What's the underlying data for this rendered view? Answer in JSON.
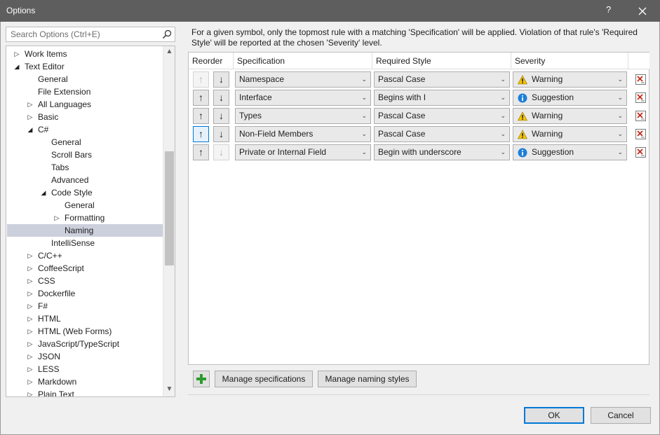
{
  "window": {
    "title": "Options",
    "help_label": "?"
  },
  "search": {
    "placeholder": "Search Options (Ctrl+E)"
  },
  "tree": {
    "items": [
      {
        "label": "Work Items",
        "expander": "collapsed"
      },
      {
        "label": "Text Editor",
        "expander": "expanded"
      },
      {
        "label": "General",
        "expander": "none"
      },
      {
        "label": "File Extension",
        "expander": "none"
      },
      {
        "label": "All Languages",
        "expander": "collapsed"
      },
      {
        "label": "Basic",
        "expander": "collapsed"
      },
      {
        "label": "C#",
        "expander": "expanded"
      },
      {
        "label": "General",
        "expander": "none"
      },
      {
        "label": "Scroll Bars",
        "expander": "none"
      },
      {
        "label": "Tabs",
        "expander": "none"
      },
      {
        "label": "Advanced",
        "expander": "none"
      },
      {
        "label": "Code Style",
        "expander": "expanded"
      },
      {
        "label": "General",
        "expander": "none"
      },
      {
        "label": "Formatting",
        "expander": "collapsed"
      },
      {
        "label": "Naming",
        "expander": "none",
        "selected": true
      },
      {
        "label": "IntelliSense",
        "expander": "none"
      },
      {
        "label": "C/C++",
        "expander": "collapsed"
      },
      {
        "label": "CoffeeScript",
        "expander": "collapsed"
      },
      {
        "label": "CSS",
        "expander": "collapsed"
      },
      {
        "label": "Dockerfile",
        "expander": "collapsed"
      },
      {
        "label": "F#",
        "expander": "collapsed"
      },
      {
        "label": "HTML",
        "expander": "collapsed"
      },
      {
        "label": "HTML (Web Forms)",
        "expander": "collapsed"
      },
      {
        "label": "JavaScript/TypeScript",
        "expander": "collapsed"
      },
      {
        "label": "JSON",
        "expander": "collapsed"
      },
      {
        "label": "LESS",
        "expander": "collapsed"
      },
      {
        "label": "Markdown",
        "expander": "collapsed"
      },
      {
        "label": "Plain Text",
        "expander": "collapsed"
      }
    ]
  },
  "description": "For a given symbol, only the topmost rule with a matching 'Specification' will be applied. Violation of that rule's 'Required Style' will be reported at the chosen 'Severity' level.",
  "grid": {
    "headers": {
      "reorder": "Reorder",
      "specification": "Specification",
      "required_style": "Required Style",
      "severity": "Severity"
    },
    "rows": [
      {
        "specification": "Namespace",
        "style": "Pascal Case",
        "severity": "Warning",
        "severity_icon": "warning-icon",
        "up_enabled": false,
        "down_enabled": true
      },
      {
        "specification": "Interface",
        "style": "Begins with I",
        "severity": "Suggestion",
        "severity_icon": "info-icon",
        "up_enabled": true,
        "down_enabled": true
      },
      {
        "specification": "Types",
        "style": "Pascal Case",
        "severity": "Warning",
        "severity_icon": "warning-icon",
        "up_enabled": true,
        "down_enabled": true
      },
      {
        "specification": "Non-Field Members",
        "style": "Pascal Case",
        "severity": "Warning",
        "severity_icon": "warning-icon",
        "up_enabled": true,
        "down_enabled": true
      },
      {
        "specification": "Private or Internal Field",
        "style": "Begin with underscore",
        "severity": "Suggestion",
        "severity_icon": "info-icon",
        "up_enabled": true,
        "down_enabled": false
      }
    ]
  },
  "buttons": {
    "manage_specifications": "Manage specifications",
    "manage_naming_styles": "Manage naming styles",
    "ok": "OK",
    "cancel": "Cancel"
  },
  "colors": {
    "titlebar": "#5e5e5e",
    "selection": "#ccd0dc",
    "warning": "#f5c400",
    "info": "#1e7fd8",
    "add": "#2d9b2d",
    "delete": "#c42b1c"
  }
}
